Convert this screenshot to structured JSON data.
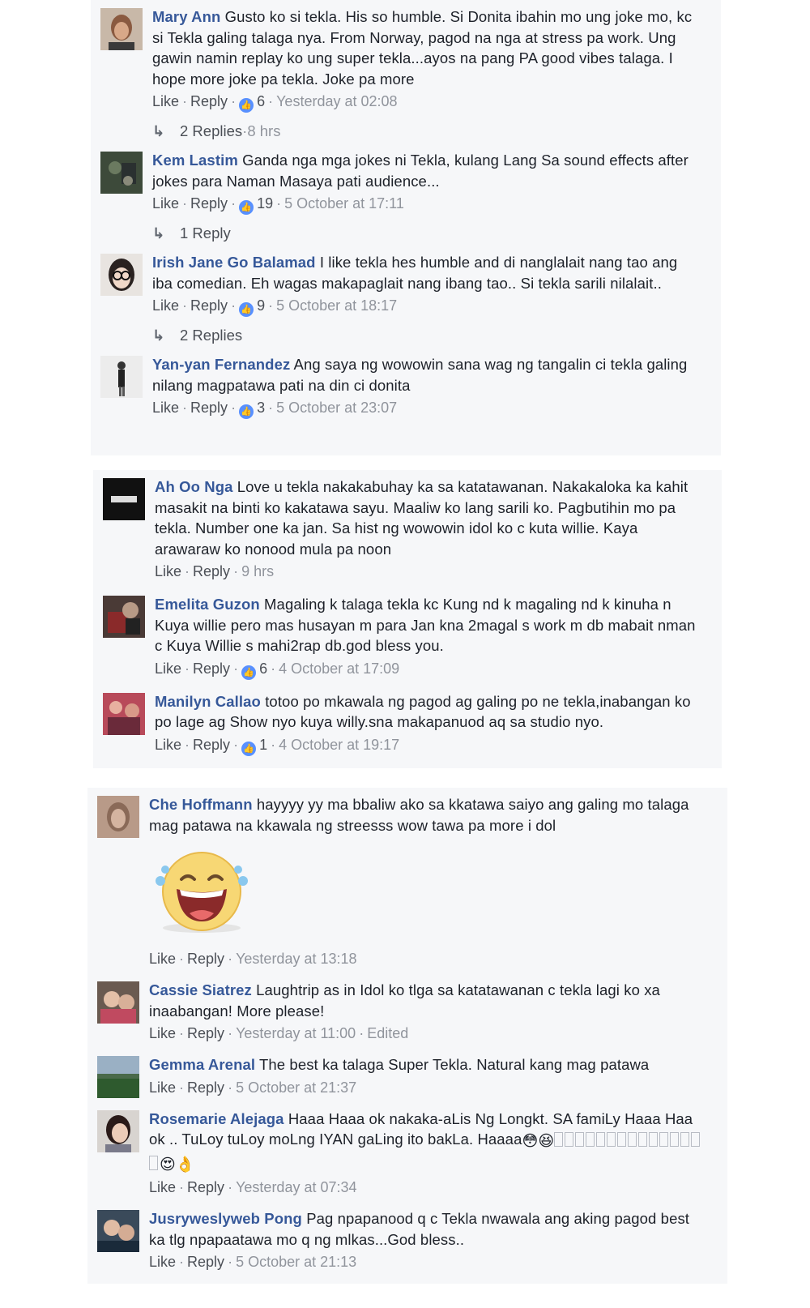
{
  "actions": {
    "like": "Like",
    "reply": "Reply",
    "sep": "·"
  },
  "panel1": {
    "c1": {
      "author": "Mary Ann",
      "text": "Gusto ko si tekla. His so humble. Si Donita ibahin mo ung joke mo, kc si Tekla galing talaga nya. From Norway, pagod na nga at stress pa work. Ung gawin namin replay ko ung super tekla...ayos na pang PA good vibes talaga. I hope more joke pa tekla. Joke pa more",
      "likes": "6",
      "time": "Yesterday at 02:08",
      "replies": "2 Replies",
      "replies_time": "8 hrs"
    },
    "c2": {
      "author": "Kem Lastim",
      "text": "Ganda nga mga jokes ni Tekla, kulang Lang Sa sound effects after jokes para Naman Masaya pati audience...",
      "likes": "19",
      "time": "5 October at 17:11",
      "replies": "1 Reply"
    },
    "c3": {
      "author": "Irish Jane Go Balamad",
      "text": "I like tekla hes humble and di nanglalait nang tao ang iba comedian. Eh wagas makapaglait nang ibang tao.. Si tekla sarili nilalait..",
      "likes": "9",
      "time": "5 October at 18:17",
      "replies": "2 Replies"
    },
    "c4": {
      "author": "Yan-yan Fernandez",
      "text": "Ang saya ng wowowin sana wag ng tangalin ci tekla galing nilang magpatawa pati na din ci donita",
      "likes": "3",
      "time": "5 October at 23:07"
    }
  },
  "panel2": {
    "c1": {
      "author": "Ah Oo Nga",
      "text": "Love u tekla nakakabuhay ka sa katatawanan. Nakakaloka ka kahit masakit na binti ko kakatawa sayu. Maaliw ko lang sarili ko. Pagbutihin mo pa tekla. Number one ka jan. Sa hist ng wowowin idol ko c kuta willie. Kaya arawaraw ko nonood mula pa noon",
      "time": "9 hrs"
    },
    "c2": {
      "author": "Emelita Guzon",
      "text": "Magaling k talaga tekla kc Kung nd k magaling nd k kinuha n Kuya willie pero mas husayan m para Jan kna 2magal s work m db mabait nman c Kuya Willie s mahi2rap db.god bless you.",
      "likes": "6",
      "time": "4 October at 17:09"
    },
    "c3": {
      "author": "Manilyn Callao",
      "text": "totoo po mkawala ng pagod ag galing po ne tekla,inabangan ko po lage ag Show nyo kuya willy.sna makapanuod aq sa studio nyo.",
      "likes": "1",
      "time": "4 October at 19:17"
    }
  },
  "panel3": {
    "c1": {
      "author": "Che Hoffmann",
      "text": "hayyyy yy ma bbaliw ako sa kkatawa saiyo ang galing mo talaga mag patawa na kkawala ng streesss wow tawa pa more i dol",
      "time": "Yesterday at 13:18",
      "sticker": "laughing-sticker"
    },
    "c2": {
      "author": "Cassie Siatrez",
      "text": "Laughtrip as in Idol ko tlga sa katatawanan c tekla lagi ko xa inaabangan! More please!",
      "time": "Yesterday at 11:00",
      "edited": "Edited"
    },
    "c3": {
      "author": "Gemma Arenal",
      "text": "The best ka talaga Super Tekla. Natural kang mag patawa",
      "time": "5 October at 21:37"
    },
    "c4": {
      "author": "Rosemarie Alejaga",
      "text": "Haaa Haaa ok nakaka-aLis Ng Longkt. SA famiLy Haaa Haa ok .. TuLoy tuLoy moLng IYAN gaLing ito bakLa. Haaaa",
      "emoji_a": "😳😆",
      "emoji_b": "😍👌",
      "time": "Yesterday at 07:34"
    },
    "c5": {
      "author": "Jusryweslyweb Pong",
      "text": "Pag npapanood q c Tekla nwawala ang aking pagod best ka tlg npapaatawa mo q ng mlkas...God bless..",
      "time": "5 October at 21:13"
    }
  },
  "colors": {
    "link": "#365899",
    "meta": "#90949c",
    "panel": "#f6f7f9",
    "like": "#5890ff"
  }
}
